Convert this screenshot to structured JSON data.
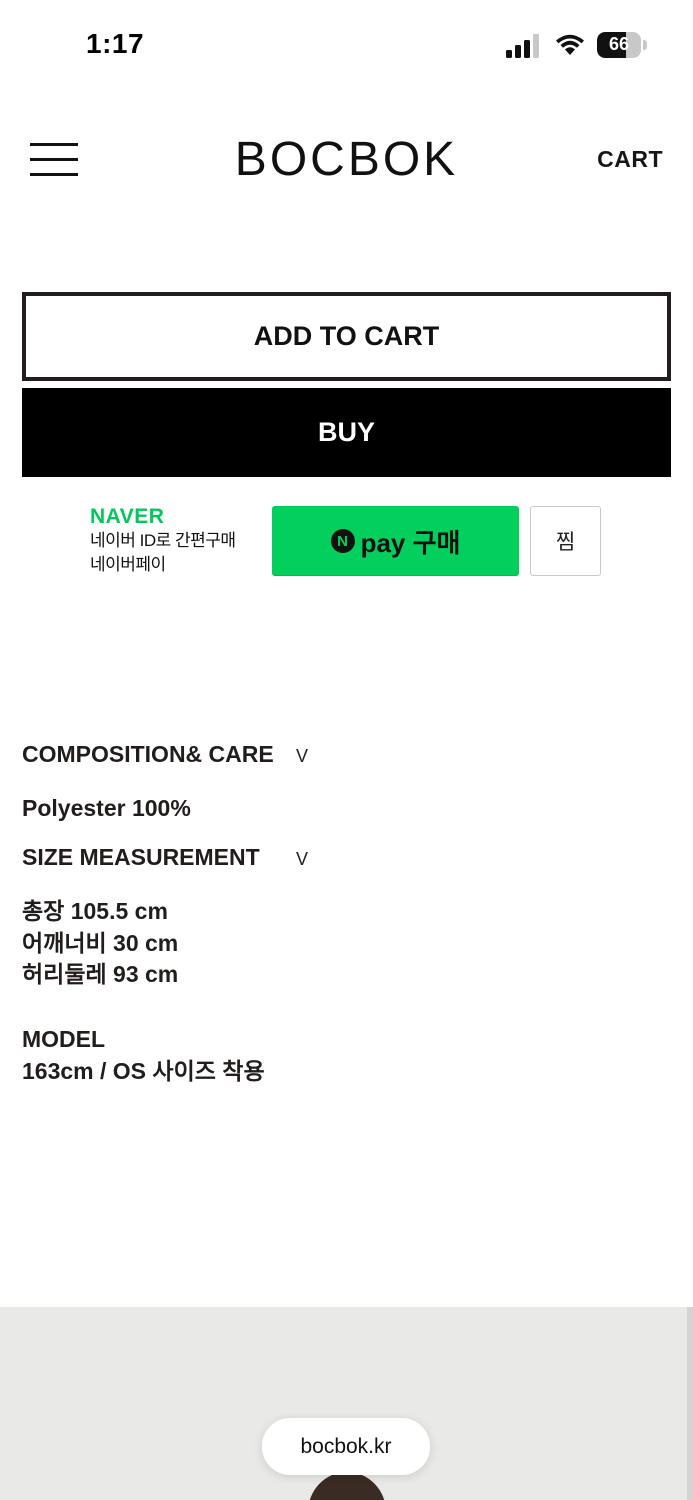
{
  "status_bar": {
    "time": "1:17",
    "battery": "66",
    "battery_level": 0.66
  },
  "header": {
    "logo": "BOCBOK",
    "cart_label": "CART"
  },
  "actions": {
    "add_to_cart": "ADD TO CART",
    "buy": "BUY"
  },
  "naver": {
    "brand": "NAVER",
    "line1": "네이버 ID로 간편구매",
    "line2": "네이버페이",
    "npay_badge": "N",
    "npay_label": "pay 구매",
    "zzim": "찜",
    "accent_color": "#03c75a"
  },
  "details": {
    "composition_title": "COMPOSITION& CARE",
    "composition_toggle": "V",
    "composition_value": "Polyester 100%",
    "size_title": "SIZE MEASUREMENT",
    "size_toggle": "V",
    "size_lines": [
      "총장 105.5 cm",
      "어깨너비 30 cm",
      "허리둘레 93 cm"
    ],
    "model_title": "MODEL",
    "model_value": "163cm / OS 사이즈 착용"
  },
  "browser": {
    "url": "bocbok.kr"
  }
}
